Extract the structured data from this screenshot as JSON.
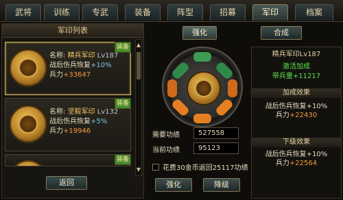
{
  "tabs": [
    {
      "label": "武将",
      "active": false
    },
    {
      "label": "训练",
      "active": false
    },
    {
      "label": "专武",
      "active": false
    },
    {
      "label": "装备",
      "active": false
    },
    {
      "label": "阵型",
      "active": false
    },
    {
      "label": "招募",
      "active": false
    },
    {
      "label": "军印",
      "active": true
    },
    {
      "label": "档案",
      "active": false
    }
  ],
  "left_panel": {
    "title": "军印列表",
    "cards": [
      {
        "name_prefix": "名称:",
        "name": "精兵军印",
        "level": "Lv187",
        "effect": "战后伤兵恢复",
        "effect_plus": "+10%",
        "troops_label": "兵力",
        "troops_plus": "+33647",
        "badge": "装备",
        "selected": true
      },
      {
        "name_prefix": "名称:",
        "name": "坚毅军印",
        "level": "Lv132",
        "effect": "战后伤兵恢复",
        "effect_plus": "+5%",
        "troops_label": "兵力",
        "troops_plus": "+19946",
        "badge": "装备",
        "selected": false
      },
      {
        "badge": "装备"
      }
    ],
    "back_label": "返回"
  },
  "center_panel": {
    "tab_strengthen": "强化",
    "tab_combine": "合成",
    "required_label": "需要功绩",
    "required_value": "527558",
    "current_label": "当前功绩",
    "current_value": "95123",
    "option_text": "花费30金币返回25117功绩",
    "btn_strengthen": "强化",
    "btn_downgrade": "降级"
  },
  "right_panel": {
    "title": "精兵军印Lv187",
    "active_bonus_title": "激活加成",
    "active_bonus": "带兵量+11217",
    "bonus_header": "加成效果",
    "bonus_effect": "战后伤兵恢复+10%",
    "bonus_troops_label": "兵力",
    "bonus_troops": "+22430",
    "next_header": "下级效果",
    "next_effect": "战后伤兵恢复+10%",
    "next_troops_label": "兵力",
    "next_troops": "+22564"
  },
  "colors": {
    "gold_name": "#f4c867",
    "green_bonus": "#5ee34a",
    "orange_troops": "#f39a3d",
    "blue_plus": "#7cc3e8"
  }
}
